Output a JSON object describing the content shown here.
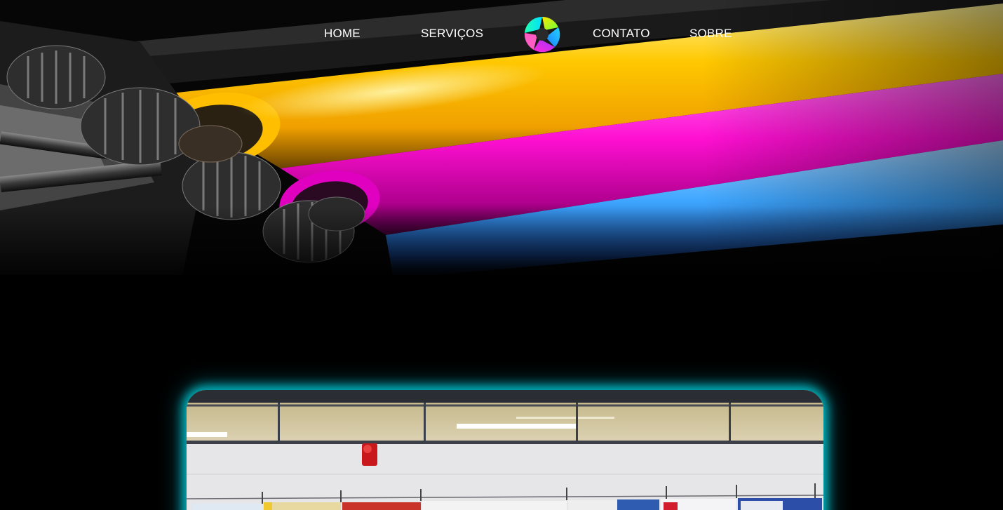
{
  "nav": {
    "items": [
      {
        "id": "home",
        "label": "HOME"
      },
      {
        "id": "servicos",
        "label": "SERVIÇOS"
      },
      {
        "id": "contato",
        "label": "CONTATO"
      },
      {
        "id": "sobre",
        "label": "SOBRE"
      }
    ]
  },
  "logo": {
    "icon": "aperture-logo-icon"
  },
  "hero": {
    "image": "printing-press-cmy-rollers"
  },
  "showcase": {
    "image": "exhibition-hall-banners"
  },
  "colors": {
    "background": "#000000",
    "nav_text": "#ffffff",
    "glow": "#00c8d2",
    "yellow": "#ffc400",
    "magenta": "#ff00c8",
    "cyan": "#3aa6ff"
  }
}
